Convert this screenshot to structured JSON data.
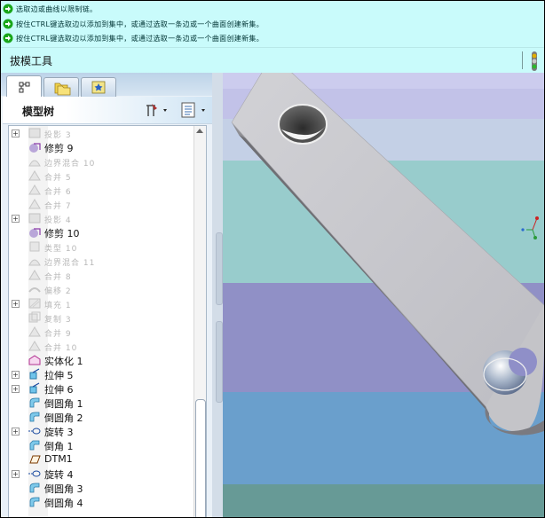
{
  "messages": [
    "选取边或曲线以限制链。",
    "按住CTRL键选取边以添加到集中，或通过选取一条边或一个曲面创建新集。",
    "按住CTRL键选取边以添加到集中，或通过选取一条边或一个曲面创建新集。"
  ],
  "toolbar": {
    "title": "拔模工具"
  },
  "panel": {
    "header": "模型树"
  },
  "tree": [
    {
      "label": "投影 3",
      "state": "suppressed",
      "expand": true,
      "icon": "projection"
    },
    {
      "label": "修剪 9",
      "state": "active",
      "expand": false,
      "icon": "trim"
    },
    {
      "label": "边界混合 10",
      "state": "suppressed",
      "expand": false,
      "icon": "boundary-blend"
    },
    {
      "label": "合并 5",
      "state": "suppressed",
      "expand": false,
      "icon": "merge"
    },
    {
      "label": "合并 6",
      "state": "suppressed",
      "expand": false,
      "icon": "merge"
    },
    {
      "label": "合并 7",
      "state": "suppressed",
      "expand": false,
      "icon": "merge"
    },
    {
      "label": "投影 4",
      "state": "suppressed",
      "expand": true,
      "icon": "projection"
    },
    {
      "label": "修剪 10",
      "state": "active",
      "expand": false,
      "icon": "trim"
    },
    {
      "label": "类型 10",
      "state": "suppressed",
      "expand": false,
      "icon": "type"
    },
    {
      "label": "边界混合 11",
      "state": "suppressed",
      "expand": false,
      "icon": "boundary-blend"
    },
    {
      "label": "合并 8",
      "state": "suppressed",
      "expand": false,
      "icon": "merge"
    },
    {
      "label": "偏移 2",
      "state": "suppressed",
      "expand": false,
      "icon": "offset"
    },
    {
      "label": "填充 1",
      "state": "suppressed",
      "expand": true,
      "icon": "fill"
    },
    {
      "label": "复制 3",
      "state": "suppressed",
      "expand": false,
      "icon": "copy"
    },
    {
      "label": "合并 9",
      "state": "suppressed",
      "expand": false,
      "icon": "merge"
    },
    {
      "label": "合并 10",
      "state": "suppressed",
      "expand": false,
      "icon": "merge"
    },
    {
      "label": "实体化 1",
      "state": "active",
      "expand": false,
      "icon": "solidify"
    },
    {
      "label": "拉伸 5",
      "state": "active",
      "expand": true,
      "icon": "extrude"
    },
    {
      "label": "拉伸 6",
      "state": "active",
      "expand": true,
      "icon": "extrude"
    },
    {
      "label": "倒圆角 1",
      "state": "active",
      "expand": false,
      "icon": "round"
    },
    {
      "label": "倒圆角 2",
      "state": "active",
      "expand": false,
      "icon": "round"
    },
    {
      "label": "旋转 3",
      "state": "active",
      "expand": true,
      "icon": "revolve"
    },
    {
      "label": "倒角 1",
      "state": "active",
      "expand": false,
      "icon": "chamfer"
    },
    {
      "label": "DTM1",
      "state": "active",
      "expand": false,
      "icon": "datum-plane"
    },
    {
      "label": "旋转 4",
      "state": "active",
      "expand": true,
      "icon": "revolve"
    },
    {
      "label": "倒圆角 3",
      "state": "active",
      "expand": false,
      "icon": "round"
    },
    {
      "label": "倒圆角 4",
      "state": "active",
      "expand": false,
      "icon": "round"
    }
  ],
  "colors": {
    "message_bg": "#c9fbfb",
    "arrow": "#1aa61a",
    "suppressed_text": "#b8b8b8",
    "part": "#c8c8cc"
  }
}
